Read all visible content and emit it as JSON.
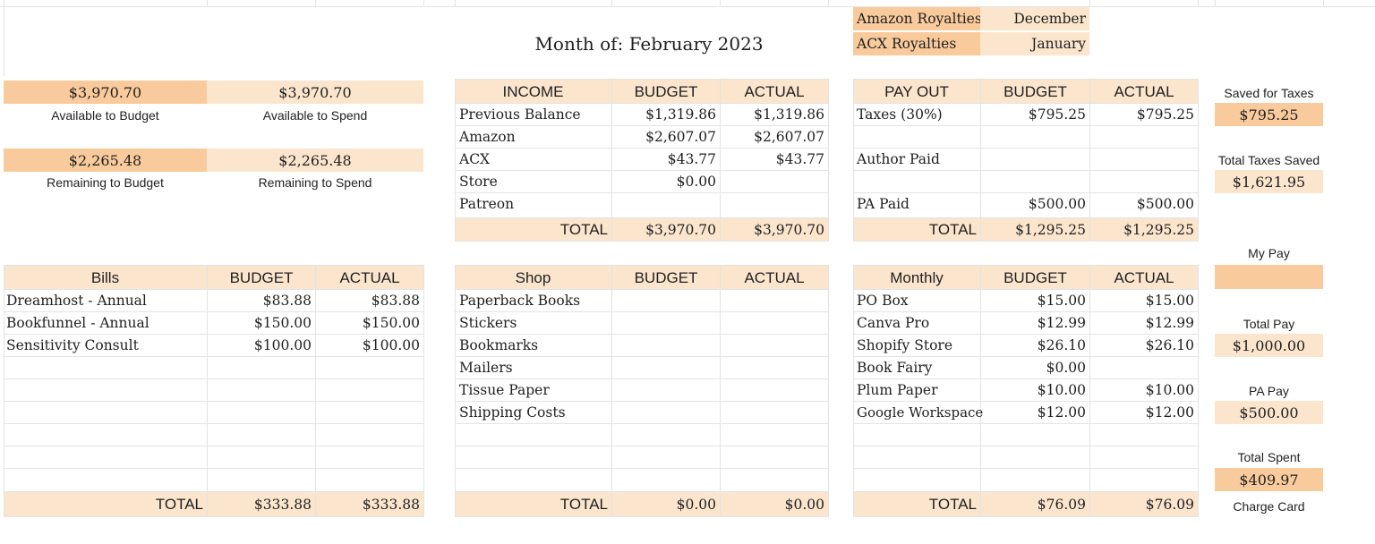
{
  "top": {
    "month_label": "Month of: February 2023",
    "royalties": [
      {
        "label": "Amazon Royalties",
        "month": "December"
      },
      {
        "label": "ACX Royalties",
        "month": "January"
      }
    ]
  },
  "summary": {
    "available_to_budget": {
      "value": "$3,970.70",
      "label": "Available to Budget"
    },
    "available_to_spend": {
      "value": "$3,970.70",
      "label": "Available to Spend"
    },
    "remaining_to_budget": {
      "value": "$2,265.48",
      "label": "Remaining to Budget"
    },
    "remaining_to_spend": {
      "value": "$2,265.48",
      "label": "Remaining to Spend"
    }
  },
  "income": {
    "headers": [
      "INCOME",
      "BUDGET",
      "ACTUAL"
    ],
    "rows": [
      {
        "label": "Previous Balance",
        "budget": "$1,319.86",
        "actual": "$1,319.86"
      },
      {
        "label": "Amazon",
        "budget": "$2,607.07",
        "actual": "$2,607.07"
      },
      {
        "label": "ACX",
        "budget": "$43.77",
        "actual": "$43.77"
      },
      {
        "label": "Store",
        "budget": "$0.00",
        "actual": ""
      },
      {
        "label": "Patreon",
        "budget": "",
        "actual": ""
      }
    ],
    "total": {
      "label": "TOTAL",
      "budget": "$3,970.70",
      "actual": "$3,970.70"
    }
  },
  "payout": {
    "headers": [
      "PAY OUT",
      "BUDGET",
      "ACTUAL"
    ],
    "rows": [
      {
        "label": "Taxes (30%)",
        "budget": "$795.25",
        "actual": "$795.25"
      },
      {
        "label": "",
        "budget": "",
        "actual": ""
      },
      {
        "label": "Author Paid",
        "budget": "",
        "actual": ""
      },
      {
        "label": "",
        "budget": "",
        "actual": ""
      },
      {
        "label": "PA Paid",
        "budget": "$500.00",
        "actual": "$500.00"
      }
    ],
    "total": {
      "label": "TOTAL",
      "budget": "$1,295.25",
      "actual": "$1,295.25"
    }
  },
  "bills": {
    "headers": [
      "Bills",
      "BUDGET",
      "ACTUAL"
    ],
    "rows": [
      {
        "label": "Dreamhost - Annual",
        "budget": "$83.88",
        "actual": "$83.88"
      },
      {
        "label": "Bookfunnel - Annual",
        "budget": "$150.00",
        "actual": "$150.00"
      },
      {
        "label": "Sensitivity Consult",
        "budget": "$100.00",
        "actual": "$100.00"
      },
      {
        "label": "",
        "budget": "",
        "actual": ""
      },
      {
        "label": "",
        "budget": "",
        "actual": ""
      },
      {
        "label": "",
        "budget": "",
        "actual": ""
      },
      {
        "label": "",
        "budget": "",
        "actual": ""
      },
      {
        "label": "",
        "budget": "",
        "actual": ""
      },
      {
        "label": "",
        "budget": "",
        "actual": ""
      }
    ],
    "total": {
      "label": "TOTAL",
      "budget": "$333.88",
      "actual": "$333.88"
    }
  },
  "shop": {
    "headers": [
      "Shop",
      "BUDGET",
      "ACTUAL"
    ],
    "rows": [
      {
        "label": "Paperback Books",
        "budget": "",
        "actual": ""
      },
      {
        "label": "Stickers",
        "budget": "",
        "actual": ""
      },
      {
        "label": "Bookmarks",
        "budget": "",
        "actual": ""
      },
      {
        "label": "Mailers",
        "budget": "",
        "actual": ""
      },
      {
        "label": "Tissue Paper",
        "budget": "",
        "actual": ""
      },
      {
        "label": "Shipping Costs",
        "budget": "",
        "actual": ""
      },
      {
        "label": "",
        "budget": "",
        "actual": ""
      },
      {
        "label": "",
        "budget": "",
        "actual": ""
      },
      {
        "label": "",
        "budget": "",
        "actual": ""
      }
    ],
    "total": {
      "label": "TOTAL",
      "budget": "$0.00",
      "actual": "$0.00"
    }
  },
  "monthly": {
    "headers": [
      "Monthly",
      "BUDGET",
      "ACTUAL"
    ],
    "rows": [
      {
        "label": "PO Box",
        "budget": "$15.00",
        "actual": "$15.00"
      },
      {
        "label": "Canva Pro",
        "budget": "$12.99",
        "actual": "$12.99"
      },
      {
        "label": "Shopify Store",
        "budget": "$26.10",
        "actual": "$26.10"
      },
      {
        "label": "Book Fairy",
        "budget": "$0.00",
        "actual": ""
      },
      {
        "label": "Plum Paper",
        "budget": "$10.00",
        "actual": "$10.00"
      },
      {
        "label": "Google Workspace",
        "budget": "$12.00",
        "actual": "$12.00"
      },
      {
        "label": "",
        "budget": "",
        "actual": ""
      },
      {
        "label": "",
        "budget": "",
        "actual": ""
      },
      {
        "label": "",
        "budget": "",
        "actual": ""
      }
    ],
    "total": {
      "label": "TOTAL",
      "budget": "$76.09",
      "actual": "$76.09"
    }
  },
  "sidebar": {
    "saved_for_taxes": {
      "label": "Saved for Taxes",
      "value": "$795.25"
    },
    "total_taxes_saved": {
      "label": "Total Taxes Saved",
      "value": "$1,621.95"
    },
    "my_pay": {
      "label": "My Pay",
      "value": ""
    },
    "total_pay": {
      "label": "Total Pay",
      "value": "$1,000.00"
    },
    "pa_pay": {
      "label": "PA Pay",
      "value": "$500.00"
    },
    "total_spent": {
      "label": "Total Spent",
      "value": "$409.97"
    },
    "charge_card": {
      "label": "Charge Card"
    }
  },
  "colors": {
    "fill_dark": "#f9cb9c",
    "fill_light": "#fce5cd",
    "grid": "#e2e3e3"
  }
}
